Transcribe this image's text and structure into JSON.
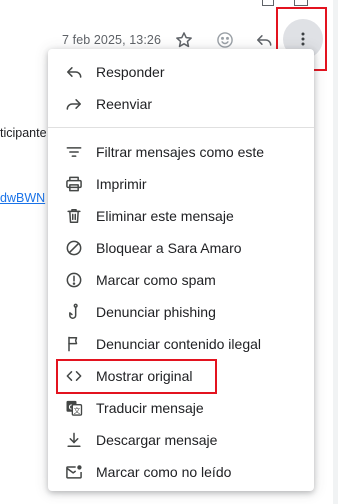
{
  "header": {
    "date": "7 feb 2025, 13:26",
    "icons": [
      "star-icon",
      "emoji-icon",
      "reply-icon",
      "more-vert-icon"
    ]
  },
  "background": {
    "participants_fragment": "ticipante",
    "link_fragment": "dwBWN"
  },
  "menu": {
    "group1": [
      {
        "icon": "reply-icon",
        "label": "Responder"
      },
      {
        "icon": "forward-icon",
        "label": "Reenviar"
      }
    ],
    "group2": [
      {
        "icon": "filter-icon",
        "label": "Filtrar mensajes como este"
      },
      {
        "icon": "print-icon",
        "label": "Imprimir"
      },
      {
        "icon": "trash-icon",
        "label": "Eliminar este mensaje"
      },
      {
        "icon": "block-icon",
        "label": "Bloquear a Sara Amaro"
      },
      {
        "icon": "spam-icon",
        "label": "Marcar como spam"
      },
      {
        "icon": "phishing-hook-icon",
        "label": "Denunciar phishing"
      },
      {
        "icon": "flag-icon",
        "label": "Denunciar contenido ilegal"
      },
      {
        "icon": "code-icon",
        "label": "Mostrar original"
      },
      {
        "icon": "translate-icon",
        "label": "Traducir mensaje"
      },
      {
        "icon": "download-icon",
        "label": "Descargar mensaje"
      },
      {
        "icon": "mark-unread-icon",
        "label": "Marcar como no leído"
      }
    ]
  },
  "colors": {
    "highlight": "#e3131f",
    "link": "#1a73e8",
    "icon": "#5f6368",
    "text": "#202124"
  }
}
